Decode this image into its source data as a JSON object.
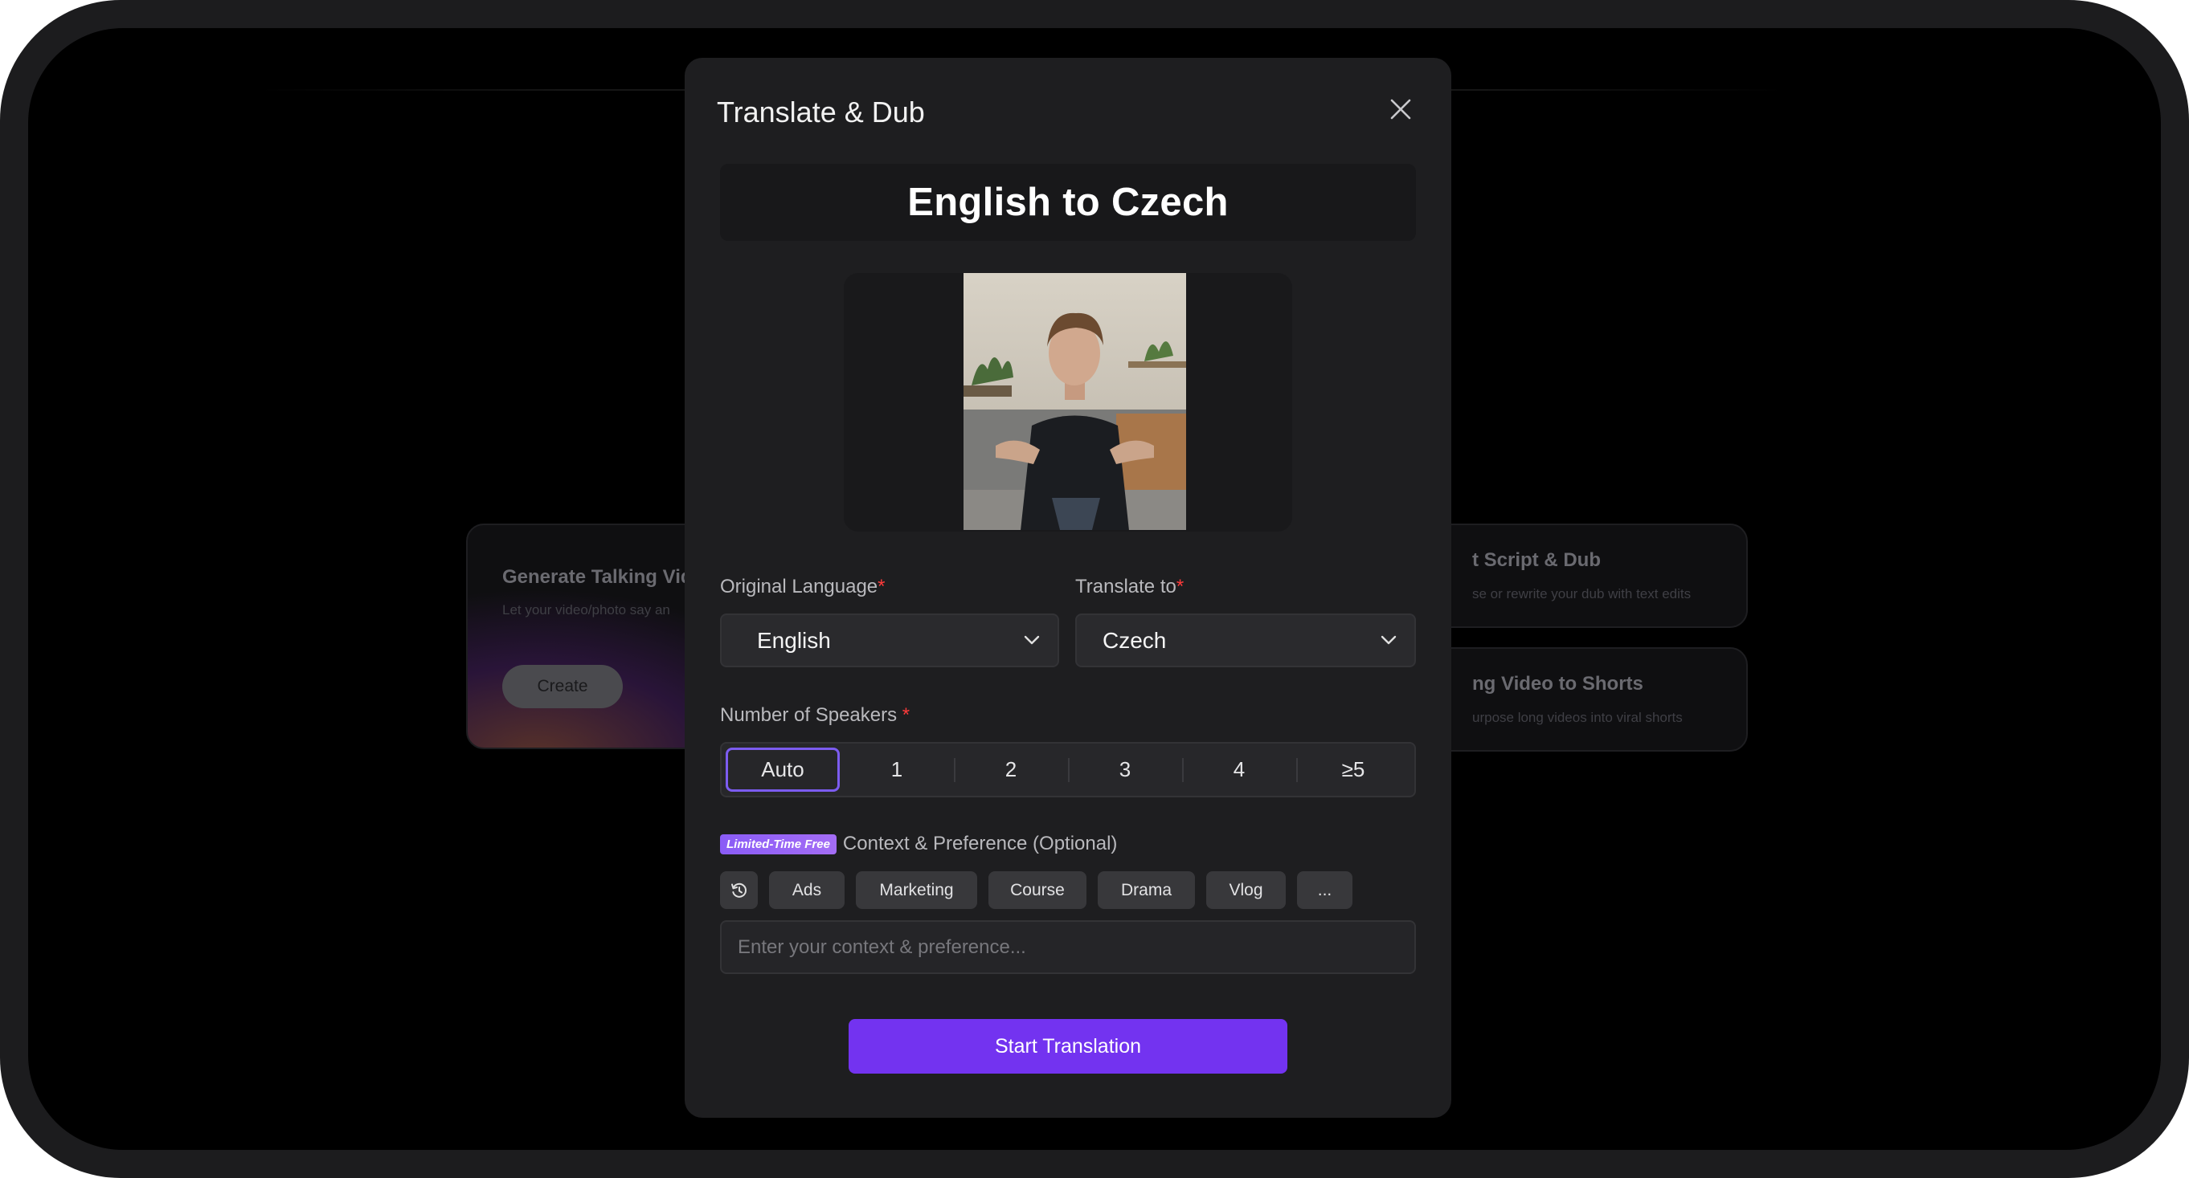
{
  "background": {
    "talking_card": {
      "title": "Generate Talking Vid",
      "subtitle": "Let your video/photo say an",
      "button": "Create"
    },
    "script_card": {
      "title": "t Script & Dub",
      "subtitle": "se or rewrite your dub with text edits"
    },
    "shorts_card": {
      "title": "ng Video to Shorts",
      "subtitle": "urpose long videos into viral shorts"
    }
  },
  "modal": {
    "title": "Translate & Dub",
    "close_icon": "close-icon",
    "banner": "English to Czech",
    "original_language": {
      "label": "Original Language",
      "required_mark": "*",
      "value": "English"
    },
    "translate_to": {
      "label": "Translate to",
      "required_mark": "*",
      "value": "Czech"
    },
    "speakers": {
      "label": "Number of Speakers ",
      "required_mark": "*",
      "options": [
        "Auto",
        "1",
        "2",
        "3",
        "4",
        "≥5"
      ],
      "selected": "Auto"
    },
    "context": {
      "badge": "Limited-Time Free",
      "label": "Context & Preference (Optional)",
      "history_icon": "history-icon",
      "chips": [
        "Ads",
        "Marketing",
        "Course",
        "Drama",
        "Vlog",
        "..."
      ],
      "placeholder": "Enter your context & preference..."
    },
    "start_button": "Start Translation",
    "colors": {
      "accent": "#7333f0",
      "selected_border": "#7c5cf0",
      "required": "#ff3b3b",
      "badge": "#8a5cf6"
    }
  }
}
